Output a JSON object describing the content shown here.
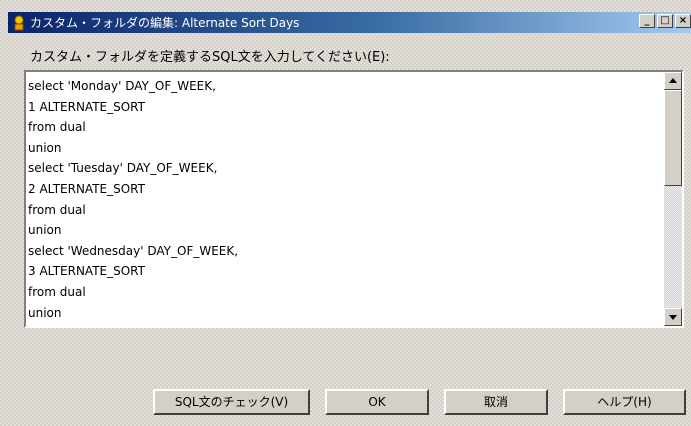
{
  "window": {
    "title": "カスタム・フォルダの編集: Alternate Sort Days",
    "controls": {
      "minimize": "_",
      "maximize": "□",
      "close": "×"
    }
  },
  "editor": {
    "label": "カスタム・フォルダを定義するSQL文を入力してください(E):",
    "lines": [
      "select 'Monday' DAY_OF_WEEK,",
      "1 ALTERNATE_SORT",
      "from dual",
      "union",
      "select 'Tuesday' DAY_OF_WEEK,",
      "2 ALTERNATE_SORT",
      "from dual",
      "union",
      "select 'Wednesday' DAY_OF_WEEK,",
      "3 ALTERNATE_SORT",
      "from dual",
      "union"
    ]
  },
  "buttons": {
    "check_sql": "SQL文のチェック(V)",
    "ok": "OK",
    "cancel": "取消",
    "help": "ヘルプ(H)"
  }
}
